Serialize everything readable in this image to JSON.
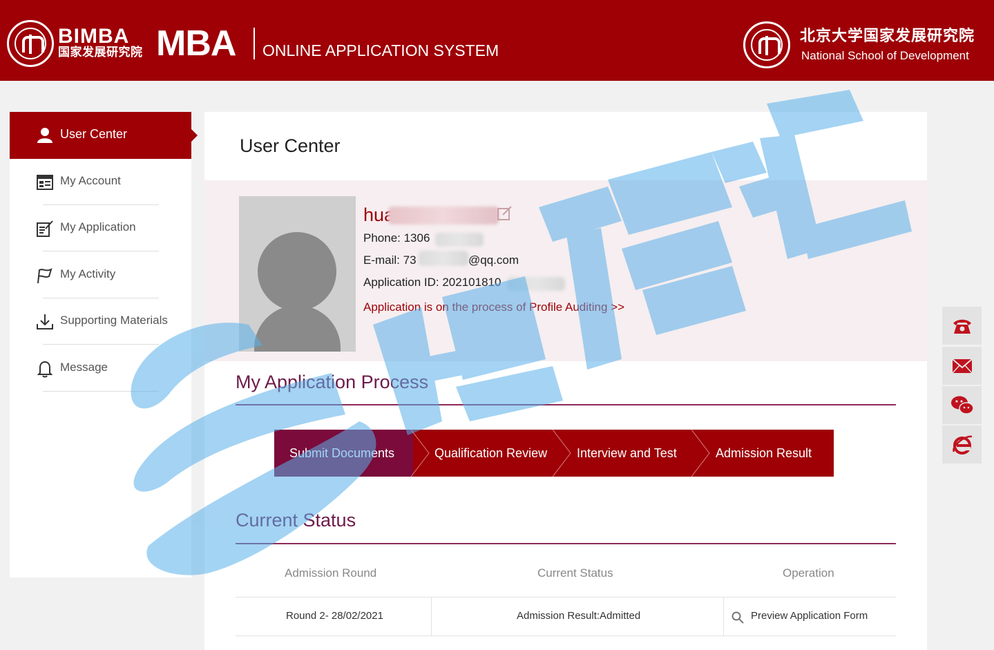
{
  "header": {
    "logo_top": "BIMBA",
    "logo_sub": "国家发展研究院",
    "logo_mba": "MBA",
    "system_title": "ONLINE APPLICATION SYSTEM",
    "school_cn": "北京大学国家发展研究院",
    "school_en": "National School of Development"
  },
  "sidebar": {
    "active": {
      "label": "User Center",
      "icon": "user-icon"
    },
    "items": [
      {
        "label": "My Account",
        "icon": "id-card-icon"
      },
      {
        "label": "My Application",
        "icon": "edit-form-icon"
      },
      {
        "label": "My Activity",
        "icon": "flag-icon"
      },
      {
        "label": "Supporting Materials",
        "icon": "download-icon"
      },
      {
        "label": "Message",
        "icon": "bell-icon"
      }
    ]
  },
  "main": {
    "page_title": "User Center",
    "profile": {
      "name_visible": "hua",
      "phone": "Phone: 1306",
      "email_prefix": "E-mail: 73",
      "email_suffix": "@qq.com",
      "application_id": "Application ID: 202101810",
      "status_link": "Application is on the process of Profile Auditing >>"
    },
    "process_title": "My Application Process",
    "steps": [
      "Submit Documents",
      "Qualification Review",
      "Interview and Test",
      "Admission Result"
    ],
    "status_title": "Current Status",
    "table": {
      "headers": [
        "Admission Round",
        "Current Status",
        "Operation"
      ],
      "rows": [
        {
          "round": "Round 2- 28/02/2021",
          "status": "Admission Result:Admitted",
          "operation": "Preview Application Form"
        }
      ]
    }
  },
  "float_toolbar": [
    "phone-icon",
    "mail-icon",
    "wechat-icon",
    "ie-browser-icon"
  ],
  "colors": {
    "brand": "#9e0006",
    "active_step": "#7a0b3a",
    "section_line": "#8c2a5a"
  },
  "watermark": "博雅汇"
}
